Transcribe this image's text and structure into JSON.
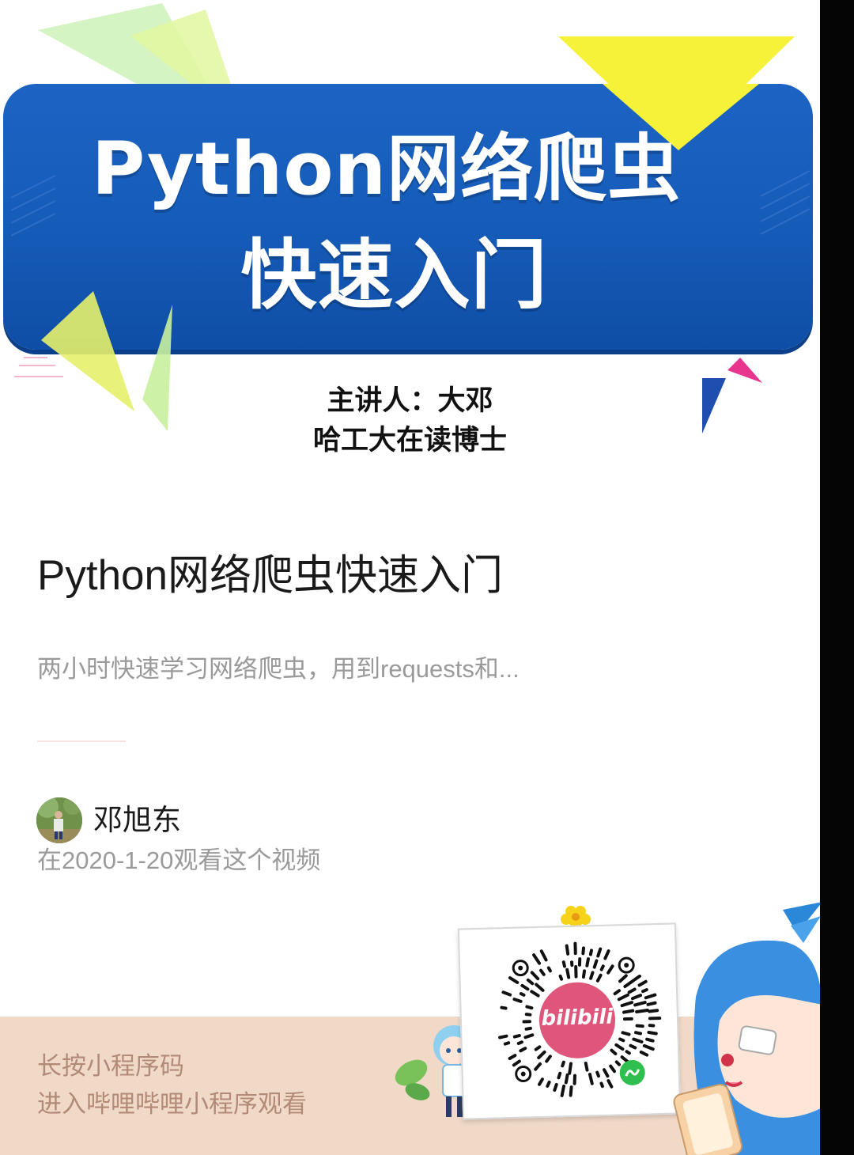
{
  "cover": {
    "banner_title_line1": "Python网络爬虫",
    "banner_title_line2": "快速入门",
    "speaker_line1": "主讲人：大邓",
    "speaker_line2": "哈工大在读博士"
  },
  "video": {
    "title": "Python网络爬虫快速入门",
    "description": "两小时快速学习网络爬虫，用到requests和..."
  },
  "user": {
    "name": "邓旭东",
    "watch_note": "在2020-1-20观看这个视频"
  },
  "footer": {
    "line1": "长按小程序码",
    "line2": "进入哔哩哔哩小程序观看",
    "qr_logo": "bilibili"
  },
  "colors": {
    "banner_blue": "#1a5fbd",
    "accent_yellow": "#f7ee3a",
    "accent_green": "#c9f07a",
    "accent_pink": "#e8368f",
    "footer_bg": "#f1d9c8",
    "footer_text": "#b28a78",
    "bilibili_pink": "#e0557a"
  },
  "icons": [
    "qr-code-icon",
    "bilibili-logo-icon",
    "miniprogram-icon",
    "avatar"
  ]
}
